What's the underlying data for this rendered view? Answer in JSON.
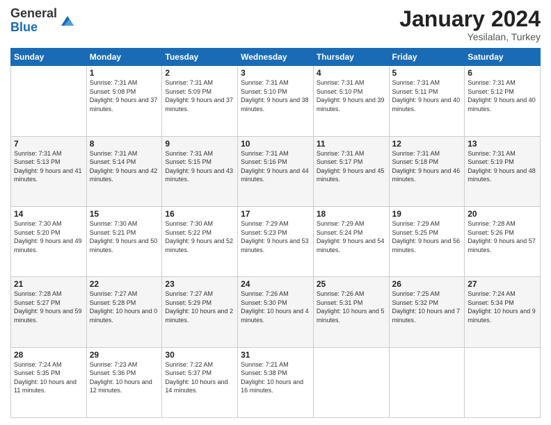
{
  "header": {
    "logo_general": "General",
    "logo_blue": "Blue",
    "month_year": "January 2024",
    "location": "Yesilalan, Turkey"
  },
  "days_of_week": [
    "Sunday",
    "Monday",
    "Tuesday",
    "Wednesday",
    "Thursday",
    "Friday",
    "Saturday"
  ],
  "weeks": [
    [
      {
        "day": "",
        "sunrise": "",
        "sunset": "",
        "daylight": ""
      },
      {
        "day": "1",
        "sunrise": "Sunrise: 7:31 AM",
        "sunset": "Sunset: 5:08 PM",
        "daylight": "Daylight: 9 hours and 37 minutes."
      },
      {
        "day": "2",
        "sunrise": "Sunrise: 7:31 AM",
        "sunset": "Sunset: 5:09 PM",
        "daylight": "Daylight: 9 hours and 37 minutes."
      },
      {
        "day": "3",
        "sunrise": "Sunrise: 7:31 AM",
        "sunset": "Sunset: 5:10 PM",
        "daylight": "Daylight: 9 hours and 38 minutes."
      },
      {
        "day": "4",
        "sunrise": "Sunrise: 7:31 AM",
        "sunset": "Sunset: 5:10 PM",
        "daylight": "Daylight: 9 hours and 39 minutes."
      },
      {
        "day": "5",
        "sunrise": "Sunrise: 7:31 AM",
        "sunset": "Sunset: 5:11 PM",
        "daylight": "Daylight: 9 hours and 40 minutes."
      },
      {
        "day": "6",
        "sunrise": "Sunrise: 7:31 AM",
        "sunset": "Sunset: 5:12 PM",
        "daylight": "Daylight: 9 hours and 40 minutes."
      }
    ],
    [
      {
        "day": "7",
        "sunrise": "Sunrise: 7:31 AM",
        "sunset": "Sunset: 5:13 PM",
        "daylight": "Daylight: 9 hours and 41 minutes."
      },
      {
        "day": "8",
        "sunrise": "Sunrise: 7:31 AM",
        "sunset": "Sunset: 5:14 PM",
        "daylight": "Daylight: 9 hours and 42 minutes."
      },
      {
        "day": "9",
        "sunrise": "Sunrise: 7:31 AM",
        "sunset": "Sunset: 5:15 PM",
        "daylight": "Daylight: 9 hours and 43 minutes."
      },
      {
        "day": "10",
        "sunrise": "Sunrise: 7:31 AM",
        "sunset": "Sunset: 5:16 PM",
        "daylight": "Daylight: 9 hours and 44 minutes."
      },
      {
        "day": "11",
        "sunrise": "Sunrise: 7:31 AM",
        "sunset": "Sunset: 5:17 PM",
        "daylight": "Daylight: 9 hours and 45 minutes."
      },
      {
        "day": "12",
        "sunrise": "Sunrise: 7:31 AM",
        "sunset": "Sunset: 5:18 PM",
        "daylight": "Daylight: 9 hours and 46 minutes."
      },
      {
        "day": "13",
        "sunrise": "Sunrise: 7:31 AM",
        "sunset": "Sunset: 5:19 PM",
        "daylight": "Daylight: 9 hours and 48 minutes."
      }
    ],
    [
      {
        "day": "14",
        "sunrise": "Sunrise: 7:30 AM",
        "sunset": "Sunset: 5:20 PM",
        "daylight": "Daylight: 9 hours and 49 minutes."
      },
      {
        "day": "15",
        "sunrise": "Sunrise: 7:30 AM",
        "sunset": "Sunset: 5:21 PM",
        "daylight": "Daylight: 9 hours and 50 minutes."
      },
      {
        "day": "16",
        "sunrise": "Sunrise: 7:30 AM",
        "sunset": "Sunset: 5:22 PM",
        "daylight": "Daylight: 9 hours and 52 minutes."
      },
      {
        "day": "17",
        "sunrise": "Sunrise: 7:29 AM",
        "sunset": "Sunset: 5:23 PM",
        "daylight": "Daylight: 9 hours and 53 minutes."
      },
      {
        "day": "18",
        "sunrise": "Sunrise: 7:29 AM",
        "sunset": "Sunset: 5:24 PM",
        "daylight": "Daylight: 9 hours and 54 minutes."
      },
      {
        "day": "19",
        "sunrise": "Sunrise: 7:29 AM",
        "sunset": "Sunset: 5:25 PM",
        "daylight": "Daylight: 9 hours and 56 minutes."
      },
      {
        "day": "20",
        "sunrise": "Sunrise: 7:28 AM",
        "sunset": "Sunset: 5:26 PM",
        "daylight": "Daylight: 9 hours and 57 minutes."
      }
    ],
    [
      {
        "day": "21",
        "sunrise": "Sunrise: 7:28 AM",
        "sunset": "Sunset: 5:27 PM",
        "daylight": "Daylight: 9 hours and 59 minutes."
      },
      {
        "day": "22",
        "sunrise": "Sunrise: 7:27 AM",
        "sunset": "Sunset: 5:28 PM",
        "daylight": "Daylight: 10 hours and 0 minutes."
      },
      {
        "day": "23",
        "sunrise": "Sunrise: 7:27 AM",
        "sunset": "Sunset: 5:29 PM",
        "daylight": "Daylight: 10 hours and 2 minutes."
      },
      {
        "day": "24",
        "sunrise": "Sunrise: 7:26 AM",
        "sunset": "Sunset: 5:30 PM",
        "daylight": "Daylight: 10 hours and 4 minutes."
      },
      {
        "day": "25",
        "sunrise": "Sunrise: 7:26 AM",
        "sunset": "Sunset: 5:31 PM",
        "daylight": "Daylight: 10 hours and 5 minutes."
      },
      {
        "day": "26",
        "sunrise": "Sunrise: 7:25 AM",
        "sunset": "Sunset: 5:32 PM",
        "daylight": "Daylight: 10 hours and 7 minutes."
      },
      {
        "day": "27",
        "sunrise": "Sunrise: 7:24 AM",
        "sunset": "Sunset: 5:34 PM",
        "daylight": "Daylight: 10 hours and 9 minutes."
      }
    ],
    [
      {
        "day": "28",
        "sunrise": "Sunrise: 7:24 AM",
        "sunset": "Sunset: 5:35 PM",
        "daylight": "Daylight: 10 hours and 11 minutes."
      },
      {
        "day": "29",
        "sunrise": "Sunrise: 7:23 AM",
        "sunset": "Sunset: 5:36 PM",
        "daylight": "Daylight: 10 hours and 12 minutes."
      },
      {
        "day": "30",
        "sunrise": "Sunrise: 7:22 AM",
        "sunset": "Sunset: 5:37 PM",
        "daylight": "Daylight: 10 hours and 14 minutes."
      },
      {
        "day": "31",
        "sunrise": "Sunrise: 7:21 AM",
        "sunset": "Sunset: 5:38 PM",
        "daylight": "Daylight: 10 hours and 16 minutes."
      },
      {
        "day": "",
        "sunrise": "",
        "sunset": "",
        "daylight": ""
      },
      {
        "day": "",
        "sunrise": "",
        "sunset": "",
        "daylight": ""
      },
      {
        "day": "",
        "sunrise": "",
        "sunset": "",
        "daylight": ""
      }
    ]
  ]
}
